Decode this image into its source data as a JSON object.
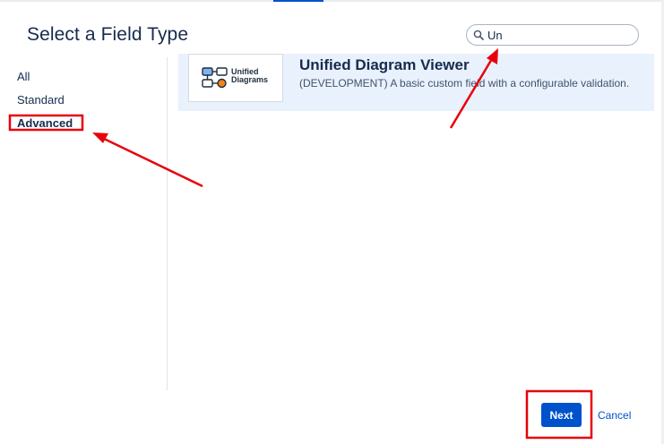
{
  "dialog": {
    "title": "Select a Field Type"
  },
  "search": {
    "value": "Un",
    "icon": "search-icon"
  },
  "sidebar": {
    "items": [
      {
        "label": "All",
        "active": false
      },
      {
        "label": "Standard",
        "active": false
      },
      {
        "label": "Advanced",
        "active": true
      }
    ]
  },
  "results": [
    {
      "logo_text_line1": "Unified",
      "logo_text_line2": "Diagrams",
      "name": "Unified Diagram Viewer",
      "description": "(DEVELOPMENT) A basic custom field with a configurable validation."
    }
  ],
  "footer": {
    "next_label": "Next",
    "cancel_label": "Cancel"
  },
  "colors": {
    "accent": "#0052cc",
    "selected_row": "#e9f1fd",
    "annotation": "#e8000b"
  }
}
